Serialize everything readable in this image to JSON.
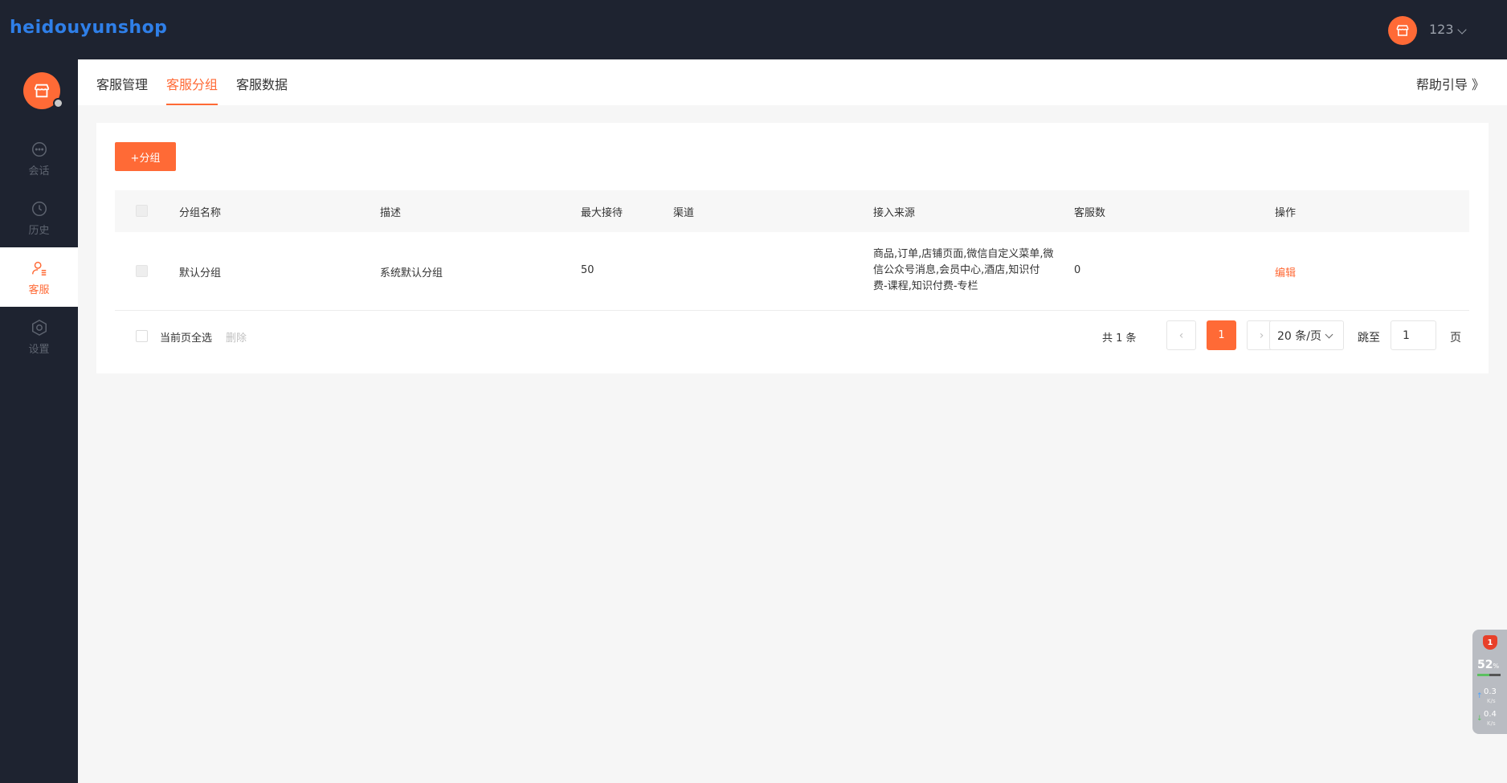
{
  "header": {
    "logo_text": "heidouyunshop",
    "user_name": "123"
  },
  "sidebar": {
    "items": [
      {
        "label": "会话",
        "icon": "chat-icon",
        "active": false
      },
      {
        "label": "历史",
        "icon": "clock-icon",
        "active": false
      },
      {
        "label": "客服",
        "icon": "user-service-icon",
        "active": true
      },
      {
        "label": "设置",
        "icon": "settings-icon",
        "active": false
      }
    ]
  },
  "tabs": {
    "items": [
      {
        "label": "客服管理",
        "active": false
      },
      {
        "label": "客服分组",
        "active": true
      },
      {
        "label": "客服数据",
        "active": false
      }
    ],
    "help_label": "帮助引导 》"
  },
  "toolbar": {
    "add_group_label": "+分组"
  },
  "table": {
    "columns": [
      "分组名称",
      "描述",
      "最大接待",
      "渠道",
      "接入来源",
      "客服数",
      "操作"
    ],
    "rows": [
      {
        "name": "默认分组",
        "description": "系统默认分组",
        "max_reception": "50",
        "channel": "",
        "source": "商品,订单,店铺页面,微信自定义菜单,微信公众号消息,会员中心,酒店,知识付费-课程,知识付费-专栏",
        "staff_count": "0",
        "action": "编辑"
      }
    ]
  },
  "footer": {
    "select_all_label": "当前页全选",
    "delete_label": "删除"
  },
  "pagination": {
    "total_text": "共 1 条",
    "current_page": "1",
    "prev_glyph": "‹",
    "next_glyph": "›",
    "page_size_label": "20 条/页",
    "jump_label": "跳至",
    "jump_value": "1",
    "jump_suffix": "页"
  },
  "widget": {
    "badge": "1",
    "cpu_percent": "52",
    "cpu_unit": "%",
    "cpu_level": 0.52,
    "upload_speed": "0.3",
    "download_speed": "0.4",
    "speed_unit": "K/s"
  },
  "colors": {
    "accent": "#ff6a36",
    "dark_bg": "#1e2330",
    "logo_blue": "#2f7fe8"
  }
}
